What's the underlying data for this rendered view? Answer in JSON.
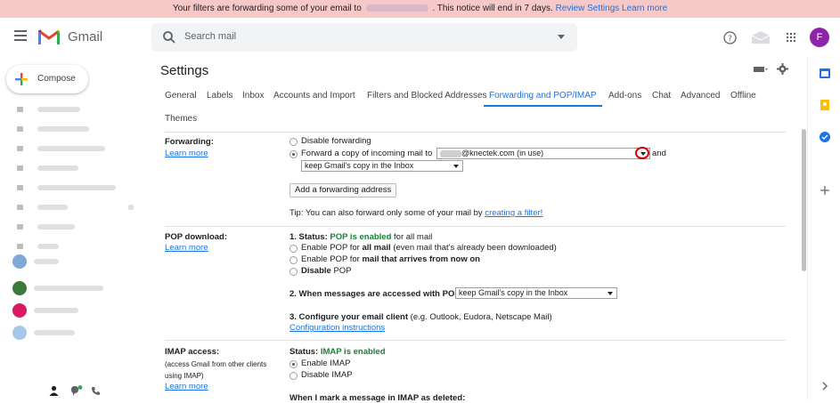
{
  "notice": {
    "before": "Your filters are forwarding some of your email to",
    "after": ". This notice will end in 7 days.",
    "review_link": "Review Settings",
    "learn_link": "Learn more"
  },
  "header": {
    "app_name": "Gmail",
    "search_placeholder": "Search mail",
    "avatar_letter": "F"
  },
  "compose": {
    "label": "Compose"
  },
  "settings": {
    "title": "Settings",
    "tabs": [
      "General",
      "Labels",
      "Inbox",
      "Accounts and Import",
      "Filters and Blocked Addresses",
      "Forwarding and POP/IMAP",
      "Add-ons",
      "Chat",
      "Advanced",
      "Offline",
      "Themes"
    ],
    "active_tab": "Forwarding and POP/IMAP"
  },
  "forwarding": {
    "label": "Forwarding:",
    "learn_more": "Learn more",
    "disable": "Disable forwarding",
    "forward_prefix": "Forward a copy of incoming mail to",
    "address_value": "@knectek.com (in use)",
    "and": "and",
    "keep_select": "keep Gmail's copy in the Inbox",
    "add_button": "Add a forwarding address",
    "tip_prefix": "Tip: You can also forward only some of your mail by",
    "tip_link": "creating a filter!"
  },
  "pop": {
    "label": "POP download:",
    "learn_more": "Learn more",
    "status_prefix": "1. Status:",
    "status_value": "POP is enabled",
    "status_suffix": "for all mail",
    "opt1_prefix": "Enable POP for",
    "opt1_bold": "all mail",
    "opt1_suffix": "(even mail that's already been downloaded)",
    "opt2_prefix": "Enable POP for",
    "opt2_bold": "mail that arrives from now on",
    "opt3_bold": "Disable",
    "opt3_suffix": "POP",
    "access_label": "2. When messages are accessed with POP",
    "access_select": "keep Gmail's copy in the Inbox",
    "configure_label": "3. Configure your email client",
    "configure_suffix": "(e.g. Outlook, Eudora, Netscape Mail)",
    "config_link": "Configuration instructions"
  },
  "imap": {
    "label": "IMAP access:",
    "sub1": "(access Gmail from other clients",
    "sub2": "using IMAP)",
    "learn_more": "Learn more",
    "status_prefix": "Status:",
    "status_value": "IMAP is enabled",
    "enable": "Enable IMAP",
    "disable": "Disable IMAP",
    "deleted_label": "When I mark a message in IMAP as deleted:"
  },
  "colors": {
    "accent": "#1a73e8",
    "green": "#188038",
    "notice_bg": "#f6c8c8",
    "avatar": "#8e24aa",
    "highlight": "#d50000"
  }
}
